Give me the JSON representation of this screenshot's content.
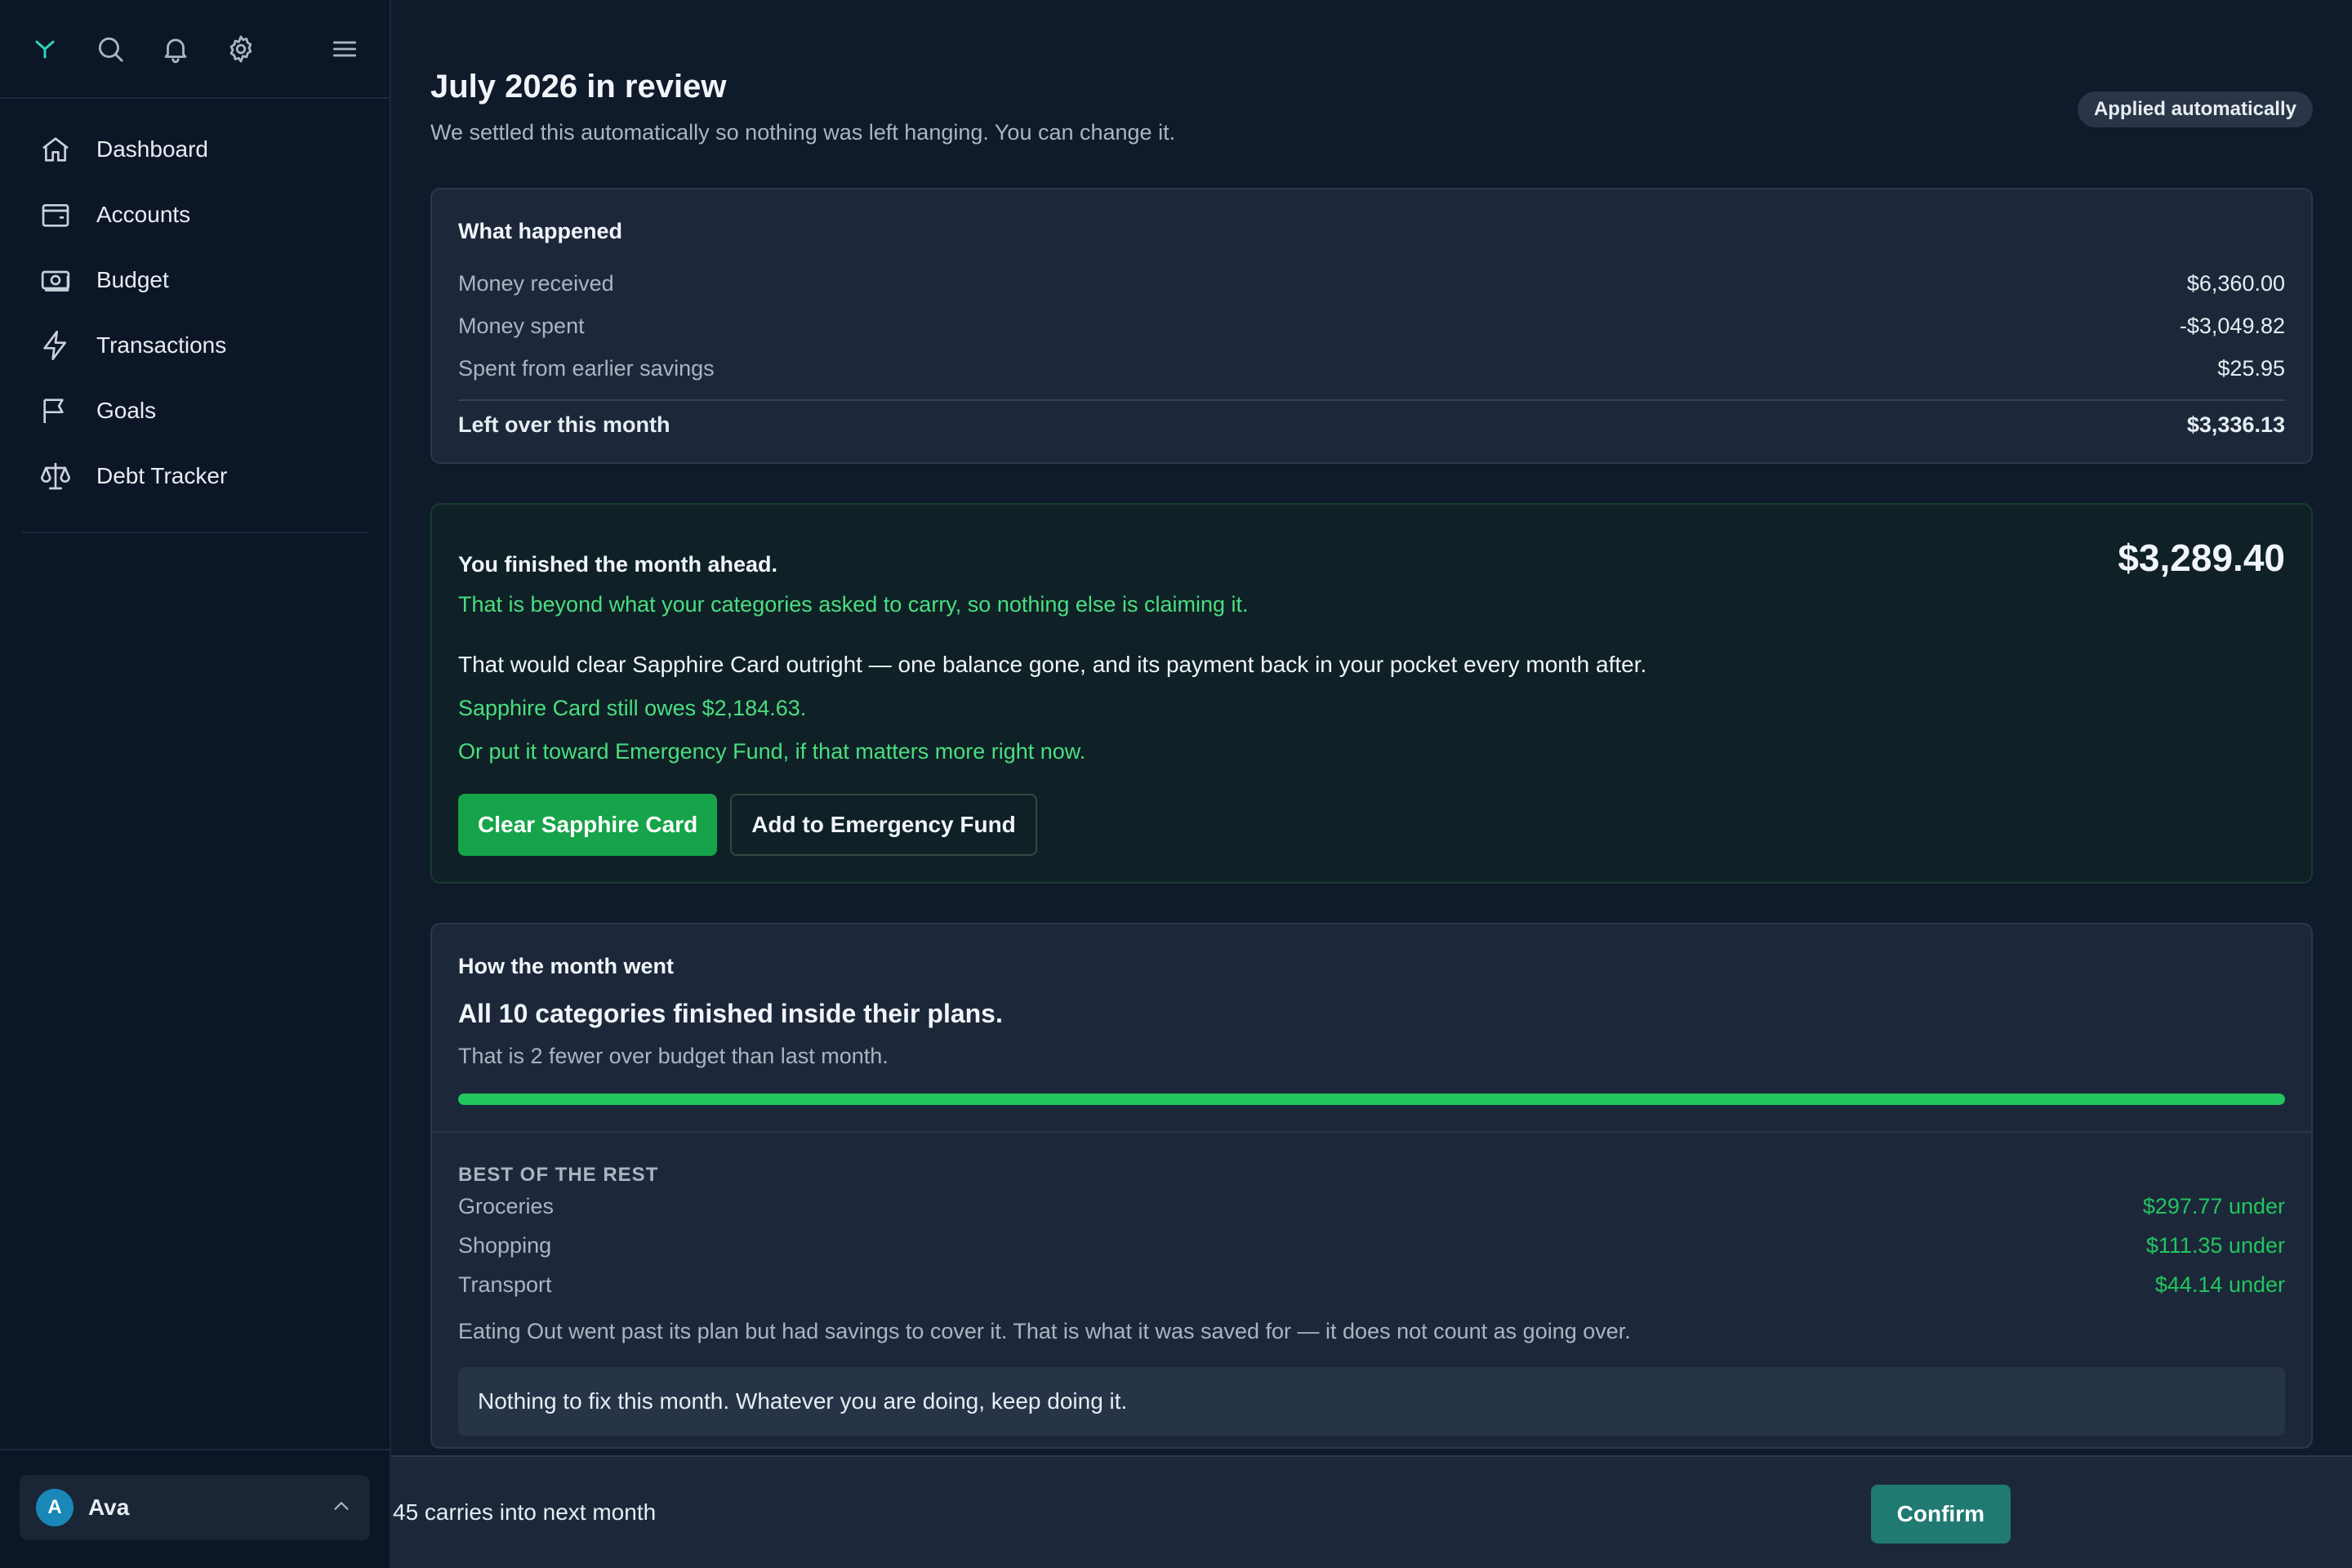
{
  "sidebar": {
    "top_icons": [
      "logo-icon",
      "search-icon",
      "bell-icon",
      "gear-icon",
      "menu-icon"
    ],
    "items": [
      {
        "label": "Dashboard",
        "icon": "home-icon"
      },
      {
        "label": "Accounts",
        "icon": "wallet-icon"
      },
      {
        "label": "Budget",
        "icon": "money-icon"
      },
      {
        "label": "Transactions",
        "icon": "bolt-icon"
      },
      {
        "label": "Goals",
        "icon": "flag-icon"
      },
      {
        "label": "Debt Tracker",
        "icon": "scale-icon"
      }
    ],
    "user": {
      "initial": "A",
      "name": "Ava"
    }
  },
  "header": {
    "title": "July 2026 in review",
    "subtitle": "We settled this automatically so nothing was left hanging. You can change it.",
    "badge": "Applied automatically"
  },
  "summary": {
    "title": "What happened",
    "rows": [
      {
        "label": "Money received",
        "value": "$6,360.00"
      },
      {
        "label": "Money spent",
        "value": "-$3,049.82"
      },
      {
        "label": "Spent from earlier savings",
        "value": "$25.95"
      }
    ],
    "total_label": "Left over this month",
    "total_value": "$3,336.13"
  },
  "ahead": {
    "title": "You finished the month ahead.",
    "amount": "$3,289.40",
    "sub": "That is beyond what your categories asked to carry, so nothing else is claiming it.",
    "body": "That would clear Sapphire Card outright — one balance gone, and its payment back in your pocket every month after.",
    "owes": "Sapphire Card still owes $2,184.63.",
    "alt": "Or put it toward Emergency Fund, if that matters more right now.",
    "primary_button": "Clear Sapphire Card",
    "secondary_button": "Add to Emergency Fund"
  },
  "month": {
    "title": "How the month went",
    "headline": "All 10 categories finished inside their plans.",
    "sub": "That is 2 fewer over budget than last month.",
    "progress_percent": 100,
    "section_label": "BEST OF THE REST",
    "categories": [
      {
        "name": "Groceries",
        "amount": "$297.77 under"
      },
      {
        "name": "Shopping",
        "amount": "$111.35 under"
      },
      {
        "name": "Transport",
        "amount": "$44.14 under"
      }
    ],
    "note": "Eating Out went past its plan but had savings to cover it. That is what it was saved for — it does not count as going over.",
    "callout": "Nothing to fix this month. Whatever you are doing, keep doing it."
  },
  "bottom_bar": {
    "carry_text": "45 carries into next month",
    "confirm_label": "Confirm"
  },
  "colors": {
    "background": "#0f1a2a",
    "card": "#1c283a",
    "accent_green": "#22c55e",
    "primary_button": "#16a34a",
    "confirm_button": "#1f7a72",
    "avatar": "#1987b8"
  }
}
